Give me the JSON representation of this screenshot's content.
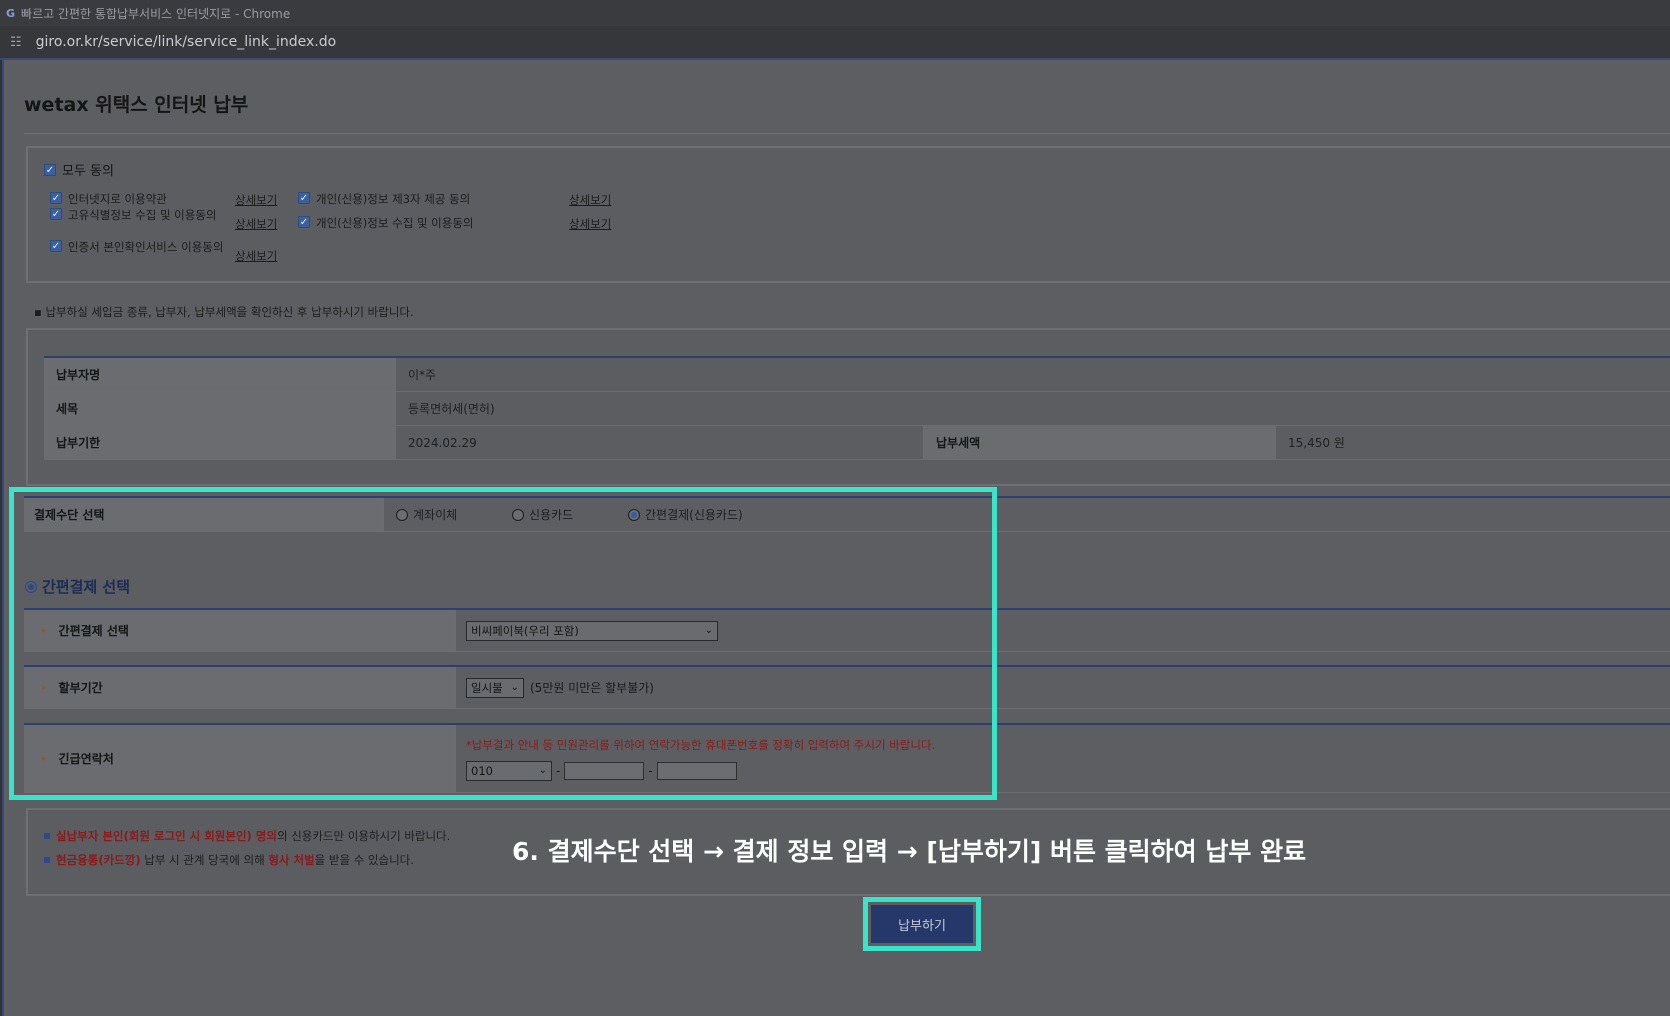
{
  "browser": {
    "window_title": "빠르고 간편한 통합납부서비스 인터넷지로 - Chrome",
    "logo_glyph": "G",
    "url": "giro.or.kr/service/link/service_link_index.do"
  },
  "page_title": "wetax 위택스 인터넷 납부",
  "agreements": {
    "all_label": "모두 동의",
    "detail_label": "상세보기",
    "items": [
      {
        "label": "인터넷지로 이용약관",
        "checked": true
      },
      {
        "label": "고유식별정보 수집 및 이용동의",
        "checked": true
      },
      {
        "label": "인증서 본인확인서비스 이용동의",
        "checked": true
      },
      {
        "label": "개인(신용)정보 제3자 제공 동의",
        "checked": true
      },
      {
        "label": "개인(신용)정보 수집 및 이용동의",
        "checked": true
      }
    ]
  },
  "notice": "납부하실 세입금 종류, 납부자, 납부세액을 확인하신 후 납부하시기 바랍니다.",
  "payment_info": {
    "payer_label": "납부자명",
    "payer_value": "이*주",
    "tax_label": "세목",
    "tax_value": "등록면허세(면허)",
    "due_label": "납부기한",
    "due_value": "2024.02.29",
    "amount_label": "납부세액",
    "amount_value": "15,450 원"
  },
  "payment_method": {
    "label": "결제수단 선택",
    "options": [
      "계좌이체",
      "신용카드",
      "간편결제(신용카드)"
    ],
    "selected": "간편결제(신용카드)"
  },
  "simple_pay": {
    "heading": "간편결제 선택",
    "select_label": "간편결제 선택",
    "select_value": "비씨페이북(우리 포함)",
    "installment_label": "할부기간",
    "installment_value": "일시불",
    "installment_note": "(5만원 미만은 할부불가)",
    "contact_label": "긴급연락처",
    "contact_hint": "*납부결과 안내 등 민원관리를 위하여 연락가능한 휴대폰번호를 정확히 입력하여 주시기 바랍니다.",
    "phone_prefix": "010",
    "phone_sep": "-"
  },
  "bottom_notes": {
    "note1_red": "실납부자 본인(회원 로그인 시 회원본인) 명의",
    "note1_rest": "의 신용카드만 이용하시기 바랍니다.",
    "note2_red1": "현금융통(카드깡)",
    "note2_mid": " 납부 시 관계 당국에 의해 ",
    "note2_red2": "형사 처벌",
    "note2_rest": "을 받을 수 있습니다."
  },
  "caption": "6. 결제수단 선택 → 결제 정보 입력 → [납부하기] 버튼 클릭하여 납부 완료",
  "pay_button": "납부하기",
  "colors": {
    "highlight": "#3de3c9",
    "dim_overlay": "#5c5e62",
    "button": "#26386a"
  }
}
